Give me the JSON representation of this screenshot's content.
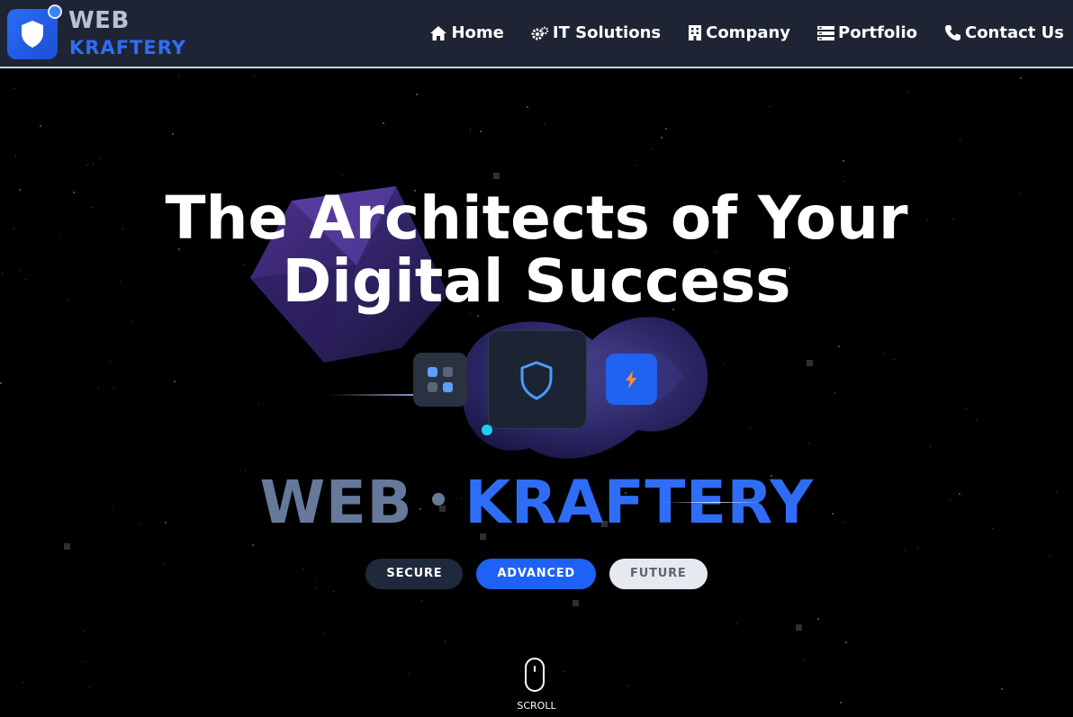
{
  "brand": {
    "top": "WEB",
    "bottom": "KRAFTERY"
  },
  "nav": {
    "items": [
      {
        "label": "Home",
        "icon": "home-icon"
      },
      {
        "label": "IT Solutions",
        "icon": "gears-icon"
      },
      {
        "label": "Company",
        "icon": "building-icon"
      },
      {
        "label": "Portfolio",
        "icon": "list-icon"
      },
      {
        "label": "Contact Us",
        "icon": "phone-icon"
      }
    ]
  },
  "hero": {
    "title_line1": "The Architects of Your",
    "title_line2": "Digital Success",
    "brand_word1": "WEB",
    "brand_sep": "•",
    "brand_word2": "KRAFTERY",
    "pills": [
      "SECURE",
      "ADVANCED",
      "FUTURE"
    ],
    "scroll_label": "SCROLL"
  },
  "colors": {
    "nav_bg": "#1e2433",
    "accent": "#2f6df6",
    "muted": "#66799a",
    "background": "#000000"
  }
}
